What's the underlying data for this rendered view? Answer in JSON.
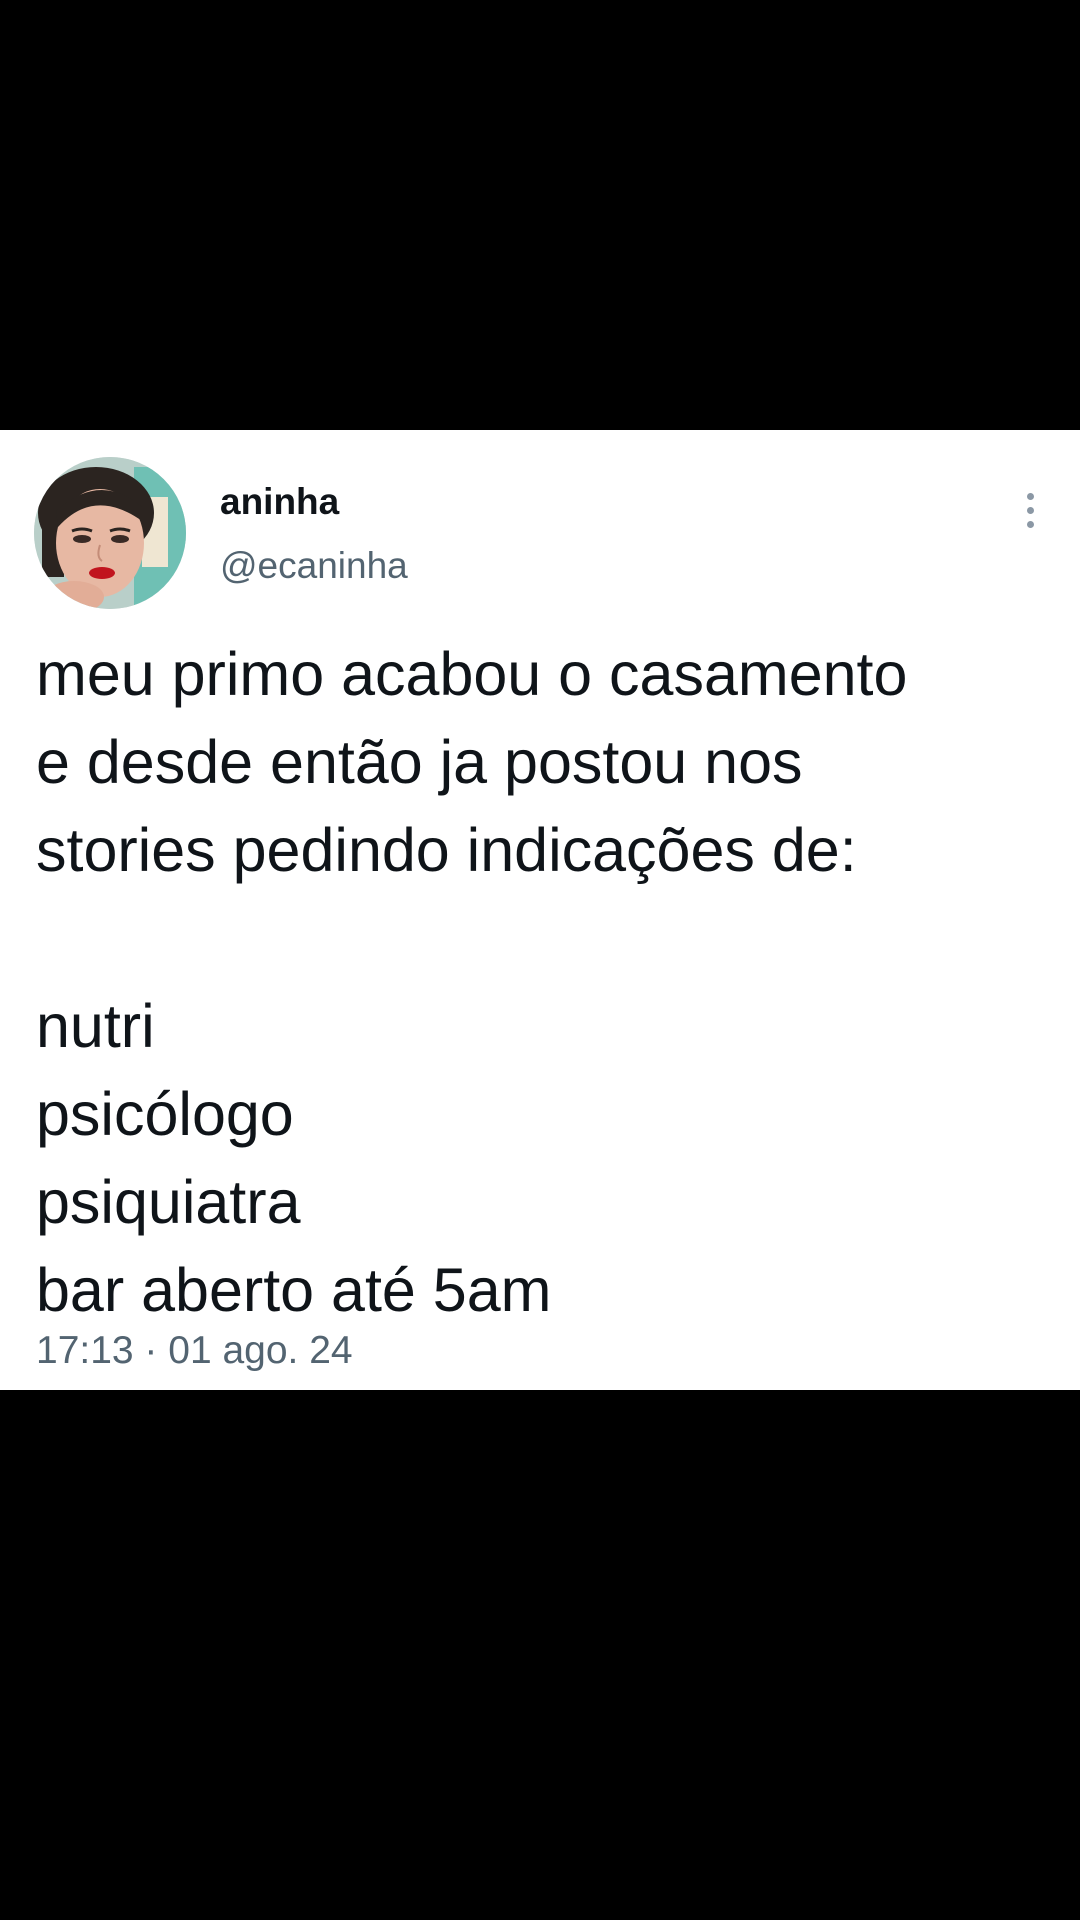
{
  "author": {
    "display_name": "aninha",
    "handle": "@ecaninha",
    "avatar_icon": "user-avatar"
  },
  "tweet": {
    "paragraph_1": [
      "meu primo acabou o casamento",
      "e desde então ja postou nos",
      "stories pedindo indicações de:"
    ],
    "list_items": [
      "nutri",
      "psicólogo",
      "psiquiatra",
      "bar aberto até 5am"
    ],
    "timestamp": "17:13 · 01 ago. 24"
  },
  "menu": {
    "icon": "more-vertical-icon"
  },
  "colors": {
    "background": "#000000",
    "card": "#ffffff",
    "primary_text": "#0f1419",
    "secondary_text": "#536471",
    "icon_gray": "#8b98a5"
  }
}
